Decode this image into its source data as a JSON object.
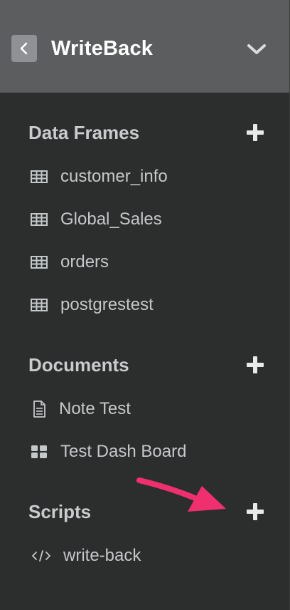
{
  "header": {
    "title": "WriteBack"
  },
  "sections": {
    "data_frames": {
      "title": "Data Frames",
      "items": [
        "customer_info",
        "Global_Sales",
        "orders",
        "postgrestest"
      ]
    },
    "documents": {
      "title": "Documents",
      "items": [
        "Note Test",
        "Test Dash Board"
      ]
    },
    "scripts": {
      "title": "Scripts",
      "items": [
        "write-back"
      ]
    }
  },
  "icons": {
    "back": "chevron-left-icon",
    "collapse": "chevron-down-icon",
    "add": "plus-icon",
    "data_frame": "table-icon",
    "note": "document-icon",
    "dashboard": "dashboard-icon",
    "script": "code-icon"
  },
  "colors": {
    "header_bg": "#5b5d5f",
    "panel_bg": "#2c2e2e",
    "annotation_arrow": "#f0306e"
  }
}
